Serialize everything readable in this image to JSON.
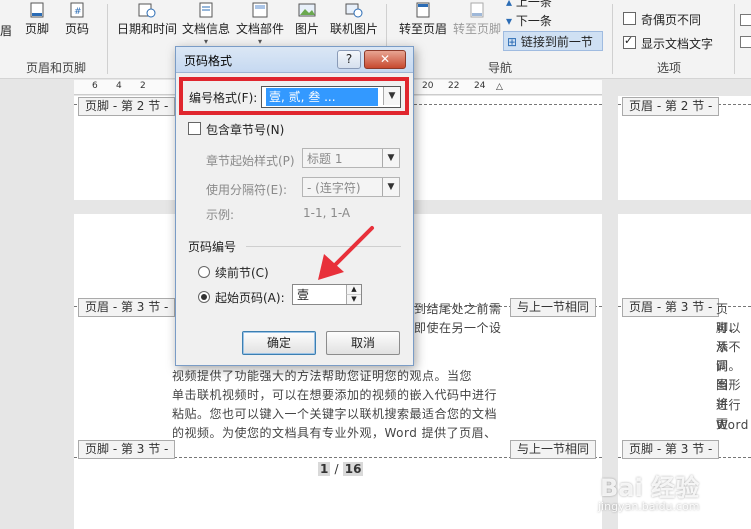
{
  "ribbon": {
    "left_partial_label": "眉",
    "footer_button": "页脚",
    "page_number_button": "页码",
    "group_header_footer": "页眉和页脚",
    "date_time_button": "日期和时间",
    "doc_info_button": "文档信息",
    "doc_parts_button": "文档部件",
    "picture_button": "图片",
    "online_picture_button": "联机图片",
    "goto_header_button": "转至页眉",
    "goto_footer_button": "转至页脚",
    "prev_button": "上一条",
    "next_button": "下一条",
    "link_previous_button": "链接到前一节",
    "group_navigation": "导航",
    "odd_even_label": "奇偶页不同",
    "show_text_label": "显示文档文字",
    "group_options": "选项"
  },
  "ruler": {
    "ticks": [
      "6",
      "4",
      "2",
      "20",
      "22",
      "24"
    ]
  },
  "document": {
    "footer_sec2": "页脚 - 第 2 节 -",
    "header_sec3": "页眉 - 第 3 节 -",
    "footer_sec3": "页脚 - 第 3 节 -",
    "same_as_prev": "与上一节相同",
    "body_right_1": "到结尾处之前需",
    "body_right_2": "即使在另一个设",
    "body_lines": [
      "视频提供了功能强大的方法帮助您证明您的观点。当您",
      "单击联机视频时，可以在想要添加的视频的嵌入代码中进行",
      "粘贴。您也可以键入一个关键字以联机搜索最适合您的文档",
      "的视频。为使您的文档具有专业外观，Word 提供了页眉、"
    ],
    "page_num_current": "1",
    "page_num_sep": "/",
    "page_num_total": "16",
    "right_page_text": [
      "页脚、",
      "可以添",
      "从不同",
      "调。当",
      "图形将",
      "进行更",
      "Word"
    ],
    "right_header": "页眉 - 第 3 节 -",
    "right_footer": "页脚 - 第 3 节 -",
    "right_footer_top": "页眉 - 第 2 节 -"
  },
  "dialog": {
    "title": "页码格式",
    "help": "?",
    "close": "✕",
    "number_format_label": "编号格式(F):",
    "number_format_value": "壹, 贰, 叁 ...",
    "include_chapter_label": "包含章节号(N)",
    "chapter_style_label": "章节起始样式(P)",
    "chapter_style_value": "标题 1",
    "separator_label": "使用分隔符(E):",
    "separator_value": "-    (连字符)",
    "example_label": "示例:",
    "example_value": "1-1, 1-A",
    "numbering_group": "页码编号",
    "continue_label": "续前节(C)",
    "start_at_label": "起始页码(A):",
    "start_at_value": "壹",
    "ok": "确定",
    "cancel": "取消"
  },
  "watermark": "Bai 经验",
  "watermark_url": "jingyan.baidu.com",
  "colors": {
    "highlight_box": "#e0262e",
    "arrow": "#e8303a",
    "selection": "#3399ff"
  }
}
